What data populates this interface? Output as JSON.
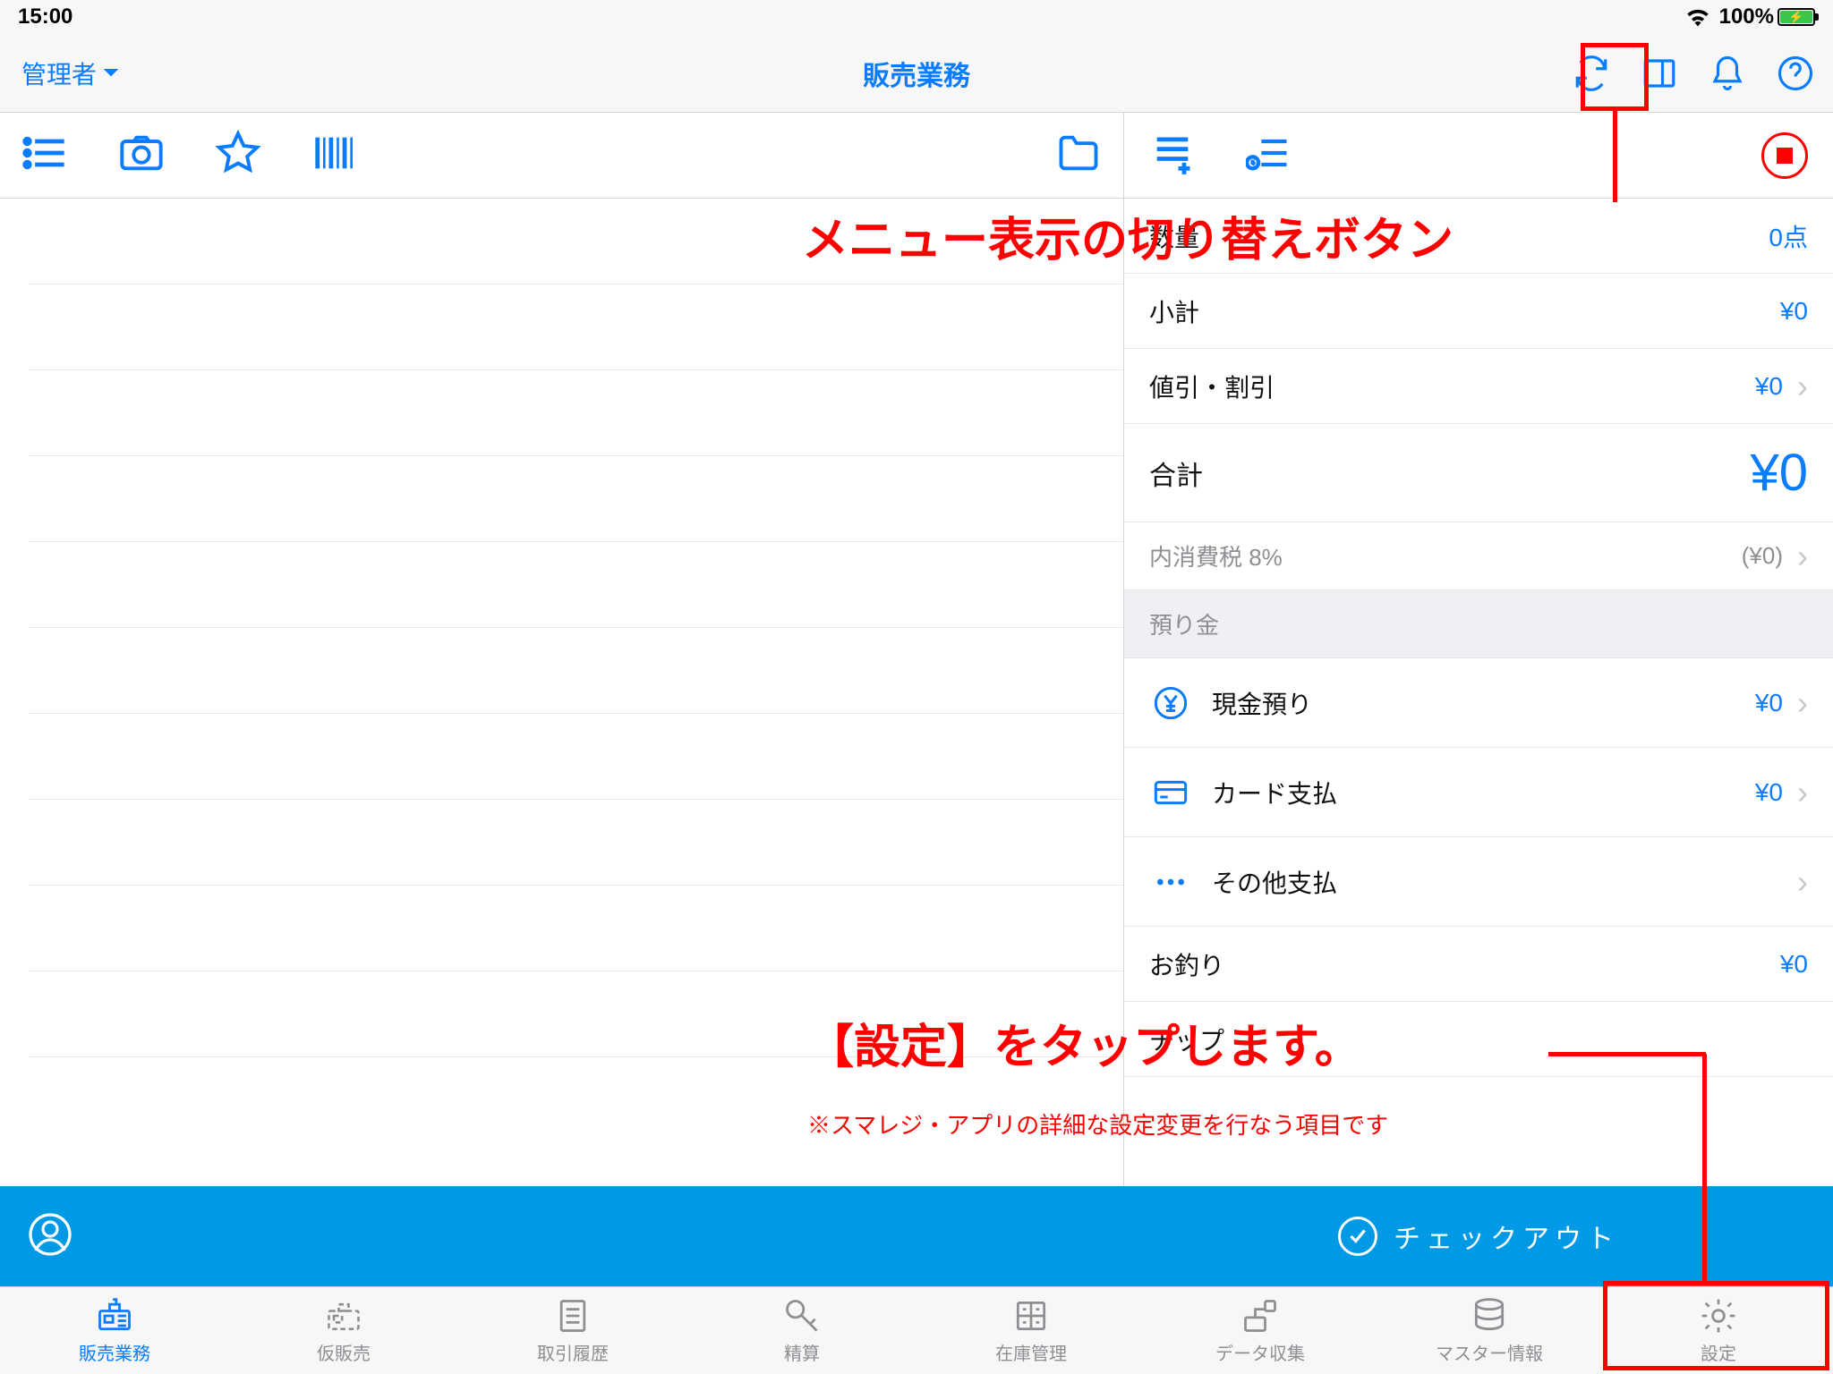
{
  "status": {
    "time": "15:00",
    "battery_pct": "100%"
  },
  "nav": {
    "user": "管理者",
    "title": "販売業務"
  },
  "summary": {
    "qty_label": "数量",
    "qty_value": "0点",
    "subtotal_label": "小計",
    "subtotal_value": "¥0",
    "discount_label": "値引・割引",
    "discount_value": "¥0",
    "total_label": "合計",
    "total_value": "¥0",
    "tax_label": "内消費税 8%",
    "tax_value": "(¥0)",
    "deposit_section": "預り金",
    "cash_label": "現金預り",
    "cash_value": "¥0",
    "card_label": "カード支払",
    "card_value": "¥0",
    "other_label": "その他支払",
    "change_label": "お釣り",
    "change_value": "¥0",
    "tip_label": "チップ"
  },
  "checkout": {
    "label": "チェックアウト"
  },
  "tabs": [
    {
      "label": "販売業務"
    },
    {
      "label": "仮販売"
    },
    {
      "label": "取引履歴"
    },
    {
      "label": "精算"
    },
    {
      "label": "在庫管理"
    },
    {
      "label": "データ収集"
    },
    {
      "label": "マスター情報"
    },
    {
      "label": "設定"
    }
  ],
  "annotations": {
    "menu_toggle": "メニュー表示の切り替えボタン",
    "settings_tap": "【設定】をタップします。",
    "settings_note": "※スマレジ・アプリの詳細な設定変更を行なう項目です"
  }
}
